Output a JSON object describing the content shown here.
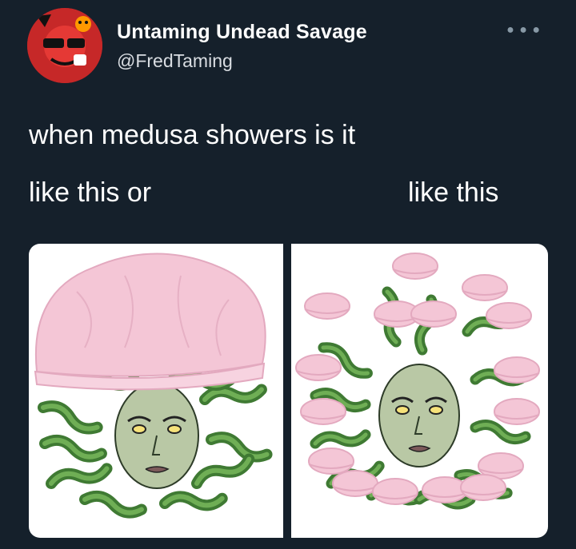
{
  "tweet": {
    "display_name": "Untaming Undead Savage",
    "handle": "@FredTaming",
    "more_icon": "more-horizontal-icon",
    "text": "when medusa showers is it",
    "caption_left": "like this or",
    "caption_right": "like this"
  },
  "colors": {
    "background": "#15202b",
    "avatar_red": "#b71c1c",
    "shower_cap_pink": "#f4c6d6",
    "snake_green": "#4f8a3c",
    "skin_green": "#b9c8a5"
  },
  "media": {
    "left_image": "medusa-with-shower-cap",
    "right_image": "medusa-snakes-with-shower-caps"
  }
}
